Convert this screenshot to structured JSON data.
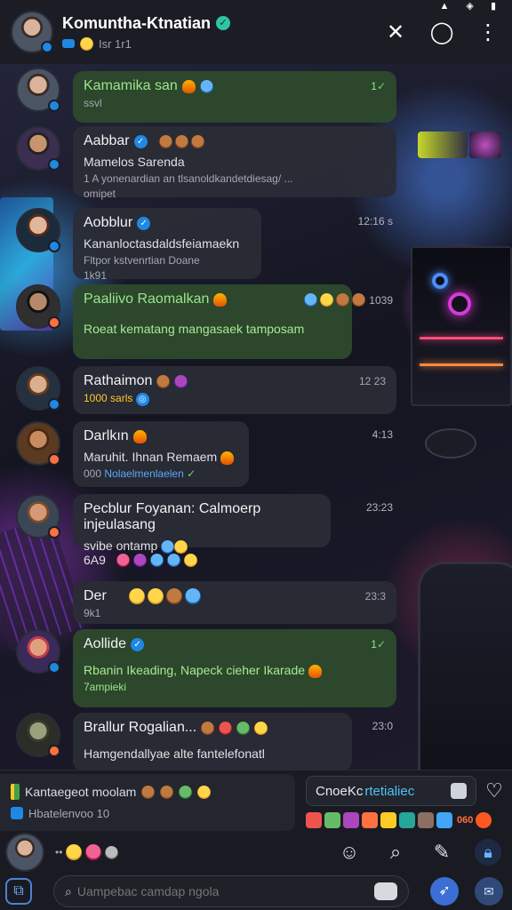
{
  "header": {
    "title": "Komuntha-Ktnatian",
    "subtitle_count": "Isr 1r1",
    "actions": [
      "close-icon",
      "chat-bubble-icon",
      "more-vert-icon"
    ]
  },
  "messages": [
    {
      "name": "Kamamika san",
      "text": "ssvl",
      "time": "1",
      "style": "green",
      "avatar": "av-a"
    },
    {
      "name": "Aabbar",
      "text": "Mamelos Sarenda",
      "sub": "1 A yonenardian an tlsanoldkandetdiesag/ ...",
      "sub2": "omipet",
      "time": "",
      "style": "dark",
      "avatar": "av-b"
    },
    {
      "name": "Aobblur",
      "text": "Kananloctasdaldsfeiamaekn",
      "sub": "Fltpor kstvenrtian Doane",
      "sub2": "1k91",
      "time": "12:16 s",
      "style": "dark",
      "avatar": "av-c"
    },
    {
      "name": "Paaliivo Raomalkan",
      "text": "Roeat kematang mangasaek tamposam",
      "time": "1039",
      "style": "green",
      "avatar": "av-d"
    },
    {
      "name": "Rathaimon",
      "text": "1000  sarls",
      "time": "12 23",
      "style": "dark",
      "avatar": "av-e"
    },
    {
      "name": "Darlkın",
      "text": "Maruhit. Ihnan Remaem",
      "sub": "000",
      "sub_link": "Nolaelmenlaelen",
      "time": "4:13",
      "style": "dark",
      "avatar": "av-f"
    },
    {
      "name": "Pecblur Foyanan: Calmoerp injeulasang",
      "text": "svibe ontamp",
      "time": "23:23",
      "side": "6A9",
      "style": "dark",
      "avatar": "av-g"
    },
    {
      "name": "Der",
      "text": "9k1",
      "time": "23:3",
      "style": "dark",
      "avatar": ""
    },
    {
      "name": "Aollide",
      "text": "Rbanin Ikeading, Napeck cieher Ikarade",
      "sub": "7ampieki",
      "time": "1",
      "style": "green",
      "avatar": "av-h"
    },
    {
      "name": "Brallur Rogalian...",
      "text": "Hamgendallyae alte fantelefonatl",
      "time": "23:0",
      "style": "dark",
      "avatar": "av-i"
    }
  ],
  "bottom": {
    "preview_line1": "Kantaegeot moolam",
    "preview_line2": "Hbatelenvoo 10",
    "check_label": "CnoeKc",
    "check_highlight": "rtetialiec",
    "sticker_count": "060",
    "input_placeholder": "Uampebac camdap ngola",
    "icons": [
      "emoji-reaction-icon",
      "search-icon",
      "edit-icon",
      "lock-icon"
    ]
  }
}
